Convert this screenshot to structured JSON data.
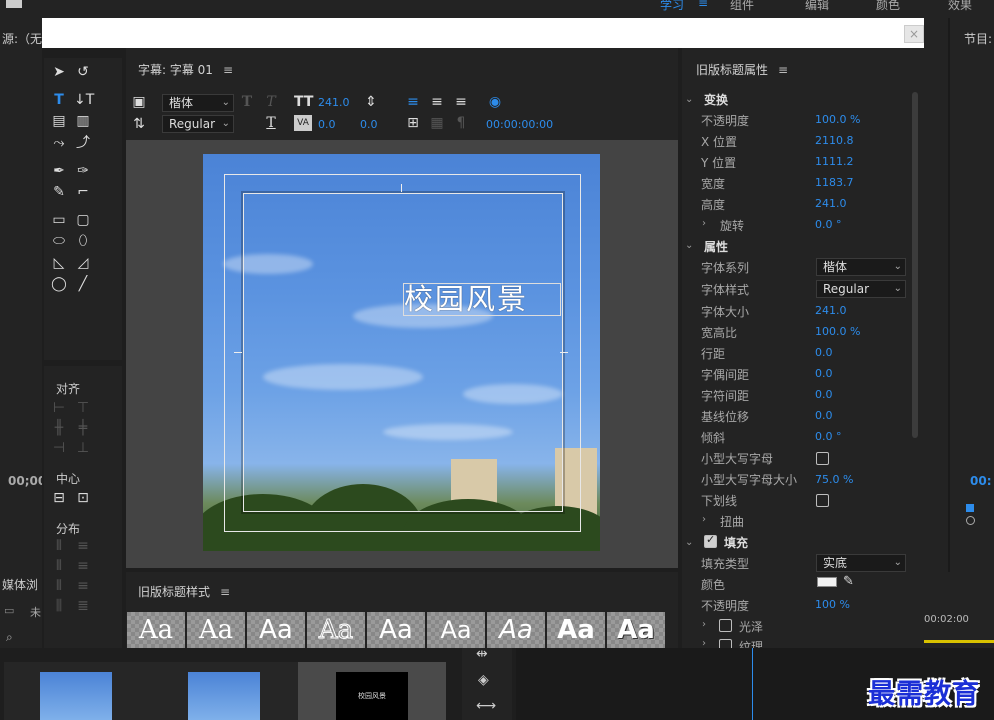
{
  "app": {
    "workspaces": [
      "学习",
      "组件",
      "编辑",
      "颜色",
      "效果"
    ],
    "source_label": "源:（无",
    "program_label": "节目:",
    "timecode_left": "00;00",
    "timecode_right": "00:",
    "media_label": "媒体浏",
    "unnamed_label": "未",
    "timeline_ruler": "00:02:00"
  },
  "titler": {
    "close_label": "×",
    "panel_title": "字幕: 字幕 01",
    "font_family": "楷体",
    "font_style": "Regular",
    "font_size": "241.0",
    "kerning": "0.0",
    "leading": "0.0",
    "tab_timecode": "00:00:00:00",
    "title_text": "校园风景"
  },
  "tools": {
    "align_label": "对齐",
    "center_label": "中心",
    "distribute_label": "分布"
  },
  "styles": {
    "panel_title": "旧版标题样式",
    "swatches": [
      "Aa",
      "Aa",
      "Aa",
      "Aa",
      "Aa",
      "Aa",
      "Aa",
      "Aa",
      "Aa"
    ]
  },
  "properties": {
    "panel_title": "旧版标题属性",
    "transform": {
      "label": "变换",
      "opacity_label": "不透明度",
      "opacity": "100.0 %",
      "x_label": "X 位置",
      "x": "2110.8",
      "y_label": "Y 位置",
      "y": "1111.2",
      "width_label": "宽度",
      "width": "1183.7",
      "height_label": "高度",
      "height": "241.0",
      "rotation_label": "旋转",
      "rotation": "0.0 °"
    },
    "attributes": {
      "label": "属性",
      "font_family_label": "字体系列",
      "font_family": "楷体",
      "font_style_label": "字体样式",
      "font_style": "Regular",
      "font_size_label": "字体大小",
      "font_size": "241.0",
      "aspect_label": "宽高比",
      "aspect": "100.0 %",
      "leading_label": "行距",
      "leading": "0.0",
      "kerning_label": "字偶间距",
      "kerning": "0.0",
      "tracking_label": "字符间距",
      "tracking": "0.0",
      "baseline_label": "基线位移",
      "baseline": "0.0",
      "slant_label": "倾斜",
      "slant": "0.0 °",
      "small_caps_label": "小型大写字母",
      "small_caps_size_label": "小型大写字母大小",
      "small_caps_size": "75.0 %",
      "underline_label": "下划线",
      "distort_label": "扭曲"
    },
    "fill": {
      "label": "填充",
      "fill_type_label": "填充类型",
      "fill_type": "实底",
      "color_label": "颜色",
      "color": "#f2f2f2",
      "opacity_label": "不透明度",
      "opacity": "100 %",
      "sheen_label": "光泽",
      "texture_label": "纹理"
    }
  },
  "watermark": "最需教育"
}
